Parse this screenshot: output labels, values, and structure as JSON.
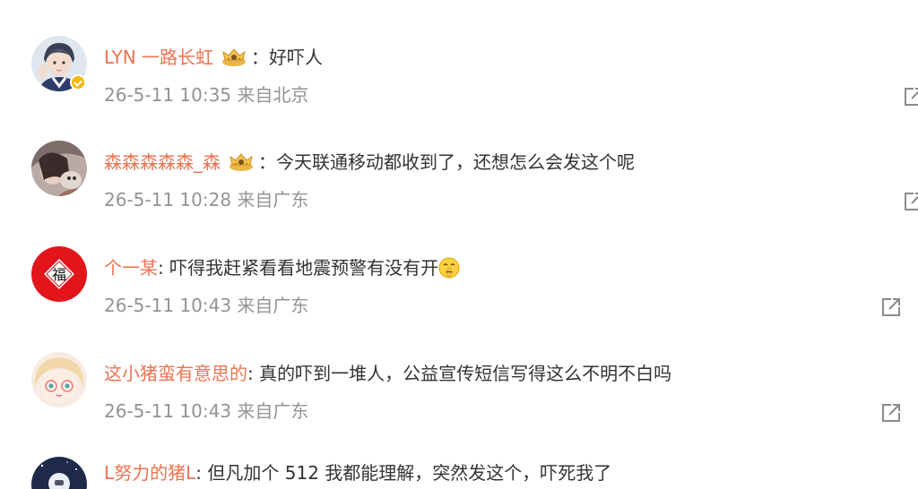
{
  "comments": [
    {
      "user": "LYN 一路长虹",
      "has_crown": true,
      "separator": "：",
      "text": "好吓人",
      "meta": "26-5-11 10:35 来自北京",
      "verified": true
    },
    {
      "user": "森森森森森_森",
      "has_crown": true,
      "separator": "：",
      "text": "今天联通移动都收到了，还想怎么会发这个呢",
      "meta": "26-5-11 10:28 来自广东"
    },
    {
      "user": "个一某",
      "separator": ": ",
      "text": "吓得我赶紧看看地震预警有没有开",
      "meta": "26-5-11 10:43 来自广东",
      "emoji": "shushing-face-emoji"
    },
    {
      "user": "这小猪蛮有意思的",
      "separator": ": ",
      "text": "真的吓到一堆人，公益宣传短信写得这么不明不白吗",
      "meta": "26-5-11 10:43 来自广东"
    },
    {
      "user": "L努力的猪L",
      "separator": ": ",
      "text": "但凡加个 512 我都能理解，突然发这个，吓死我了"
    }
  ],
  "colors": {
    "username": "#eb7350",
    "text": "#333333",
    "meta": "#939393",
    "verified": "#f5b800"
  }
}
